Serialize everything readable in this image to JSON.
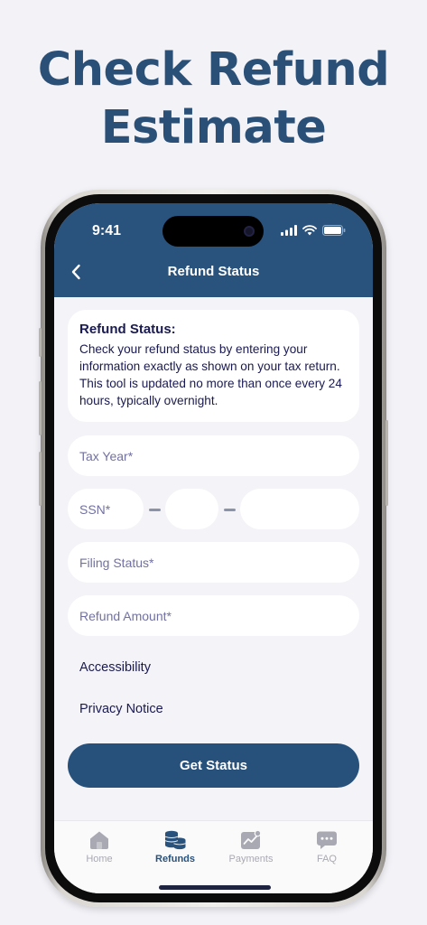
{
  "headline": {
    "line1": "Check Refund",
    "line2": "Estimate"
  },
  "status_bar": {
    "time": "9:41"
  },
  "header": {
    "title": "Refund Status",
    "back_icon": "chevron-left-icon"
  },
  "info_card": {
    "title": "Refund Status:",
    "body": "Check your refund status by entering your information exactly as shown on your tax return. This tool is updated no more than once every 24 hours, typically overnight."
  },
  "form": {
    "tax_year_placeholder": "Tax Year*",
    "ssn_placeholder": "SSN*",
    "filing_status_placeholder": "Filing Status*",
    "refund_amount_placeholder": "Refund Amount*"
  },
  "links": {
    "accessibility": "Accessibility",
    "privacy": "Privacy Notice"
  },
  "button": {
    "get_status": "Get Status"
  },
  "tabs": [
    {
      "label": "Home",
      "icon": "home-icon",
      "active": false
    },
    {
      "label": "Refunds",
      "icon": "coins-icon",
      "active": true
    },
    {
      "label": "Payments",
      "icon": "chart-icon",
      "active": false
    },
    {
      "label": "FAQ",
      "icon": "chat-icon",
      "active": false
    }
  ],
  "colors": {
    "primary": "#29527c",
    "headline": "#2a5078",
    "text_dark": "#1a1a52",
    "placeholder": "#7170a3",
    "background": "#f3f3f8"
  }
}
